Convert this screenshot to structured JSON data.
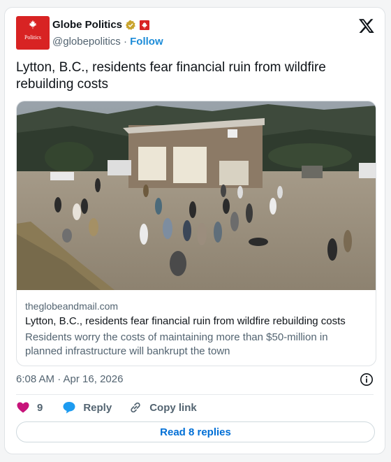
{
  "author": {
    "name": "Globe Politics",
    "handle": "@globepolitics",
    "separator": "·",
    "follow_label": "Follow",
    "avatar_text": "Politics",
    "avatar_icon": "maple-leaf-icon",
    "verified_icon": "verified-gold-badge-icon",
    "affiliate_icon": "maple-leaf-flag-icon"
  },
  "platform_icon": "x-logo-icon",
  "post": {
    "text": "Lytton, B.C., residents fear financial ruin from wildfire rebuilding costs",
    "timestamp": "6:08 AM · Apr 16, 2026"
  },
  "link_card": {
    "image": "photo of residents gathered outside a new building",
    "domain": "theglobeandmail.com",
    "title": "Lytton, B.C., residents fear financial ruin from wildfire rebuilding costs",
    "description": "Residents worry the costs of maintaining more than $50-million in planned infrastructure will bankrupt the town"
  },
  "actions": {
    "like_count": "9",
    "reply_label": "Reply",
    "copy_link_label": "Copy link",
    "read_replies_label": "Read 8 replies"
  },
  "colors": {
    "brand_red": "#d82323",
    "link_blue": "#006fd6",
    "follow_blue": "#1d8cd8",
    "like_pink": "#c7137a",
    "reply_blue": "#1d9bf0",
    "muted_text": "#536471"
  }
}
